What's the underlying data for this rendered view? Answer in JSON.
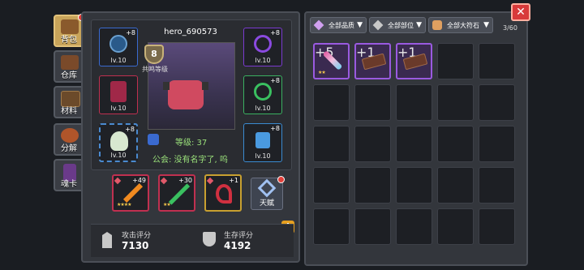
{
  "tabs": [
    {
      "label": "背包",
      "icon": "backpack-icon",
      "active": true,
      "badge": true
    },
    {
      "label": "仓库",
      "icon": "warehouse-icon",
      "active": false,
      "badge": false
    },
    {
      "label": "材料",
      "icon": "materials-icon",
      "active": false,
      "badge": false
    },
    {
      "label": "分解",
      "icon": "dismantle-icon",
      "active": false,
      "badge": false
    },
    {
      "label": "魂卡",
      "icon": "soul-card-icon",
      "active": false,
      "badge": false
    }
  ],
  "hero": {
    "name": "hero_690573",
    "resonance_level": "8",
    "resonance_label": "共鸣等级",
    "level_text": "等级: 37",
    "guild_text": "公会: 没有名字了, 呜"
  },
  "equipment": {
    "left": [
      {
        "level": "lv.10",
        "plus": "+8",
        "icon": "helmet-icon"
      },
      {
        "level": "lv.10",
        "plus": "",
        "icon": "armor-icon"
      },
      {
        "level": "lv.10",
        "plus": "+8",
        "icon": "pet-icon"
      }
    ],
    "right": [
      {
        "level": "lv.10",
        "plus": "+8",
        "icon": "amulet-icon"
      },
      {
        "level": "lv.10",
        "plus": "+8",
        "icon": "ring-icon"
      },
      {
        "level": "lv.10",
        "plus": "+8",
        "icon": "boots-icon"
      }
    ]
  },
  "skills": [
    {
      "plus": "+49",
      "stars": "★★★★",
      "icon": "flame-sword-icon"
    },
    {
      "plus": "+30",
      "stars": "★★",
      "icon": "green-staff-icon"
    },
    {
      "plus": "+1",
      "stars": "",
      "icon": "red-hook-icon"
    }
  ],
  "talent_label": "天赋",
  "stats": {
    "attack_label": "攻击评分",
    "attack_value": "7130",
    "survival_label": "生存评分",
    "survival_value": "4192"
  },
  "filters": {
    "quality": "全部品质",
    "slot": "全部部位",
    "rune": "全部大符石",
    "count": "3/60"
  },
  "inventory_items": [
    {
      "plus": "+5",
      "stars": "★★",
      "icon": "candy-staff-icon"
    },
    {
      "plus": "+1",
      "stars": "",
      "icon": "crossbow-icon"
    },
    {
      "plus": "+1",
      "stars": "",
      "icon": "crossbow-icon"
    }
  ],
  "close_icon": "close-icon",
  "info_icon": "info-icon"
}
